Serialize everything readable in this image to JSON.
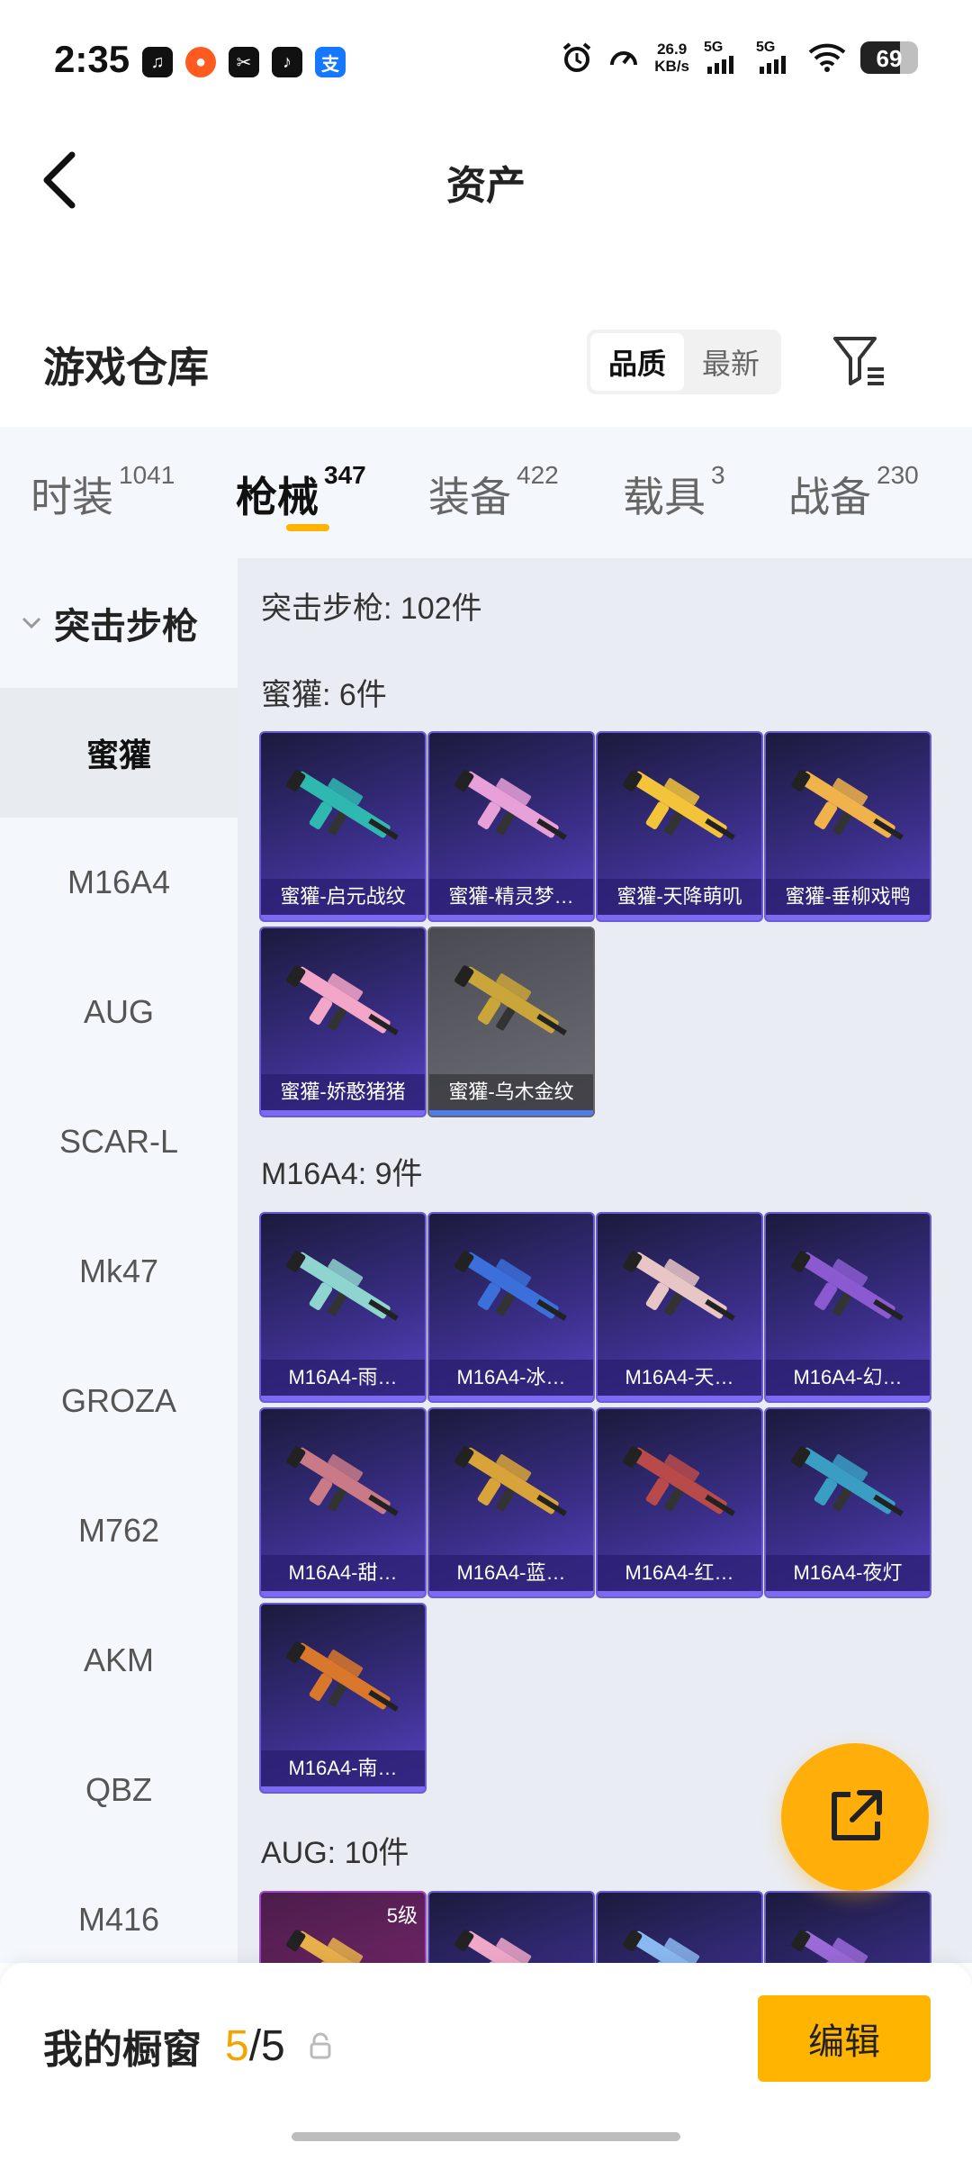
{
  "status_bar": {
    "time": "2:35",
    "net_speed": "26.9",
    "net_unit": "KB/s",
    "sim1": "5G",
    "sim2": "5G",
    "battery": "69",
    "battery_level": 0.69,
    "app_icons": [
      "music-icon",
      "red-app-icon",
      "capcut-icon",
      "tiktok-icon",
      "alipay-icon"
    ]
  },
  "header": {
    "title": "资产"
  },
  "warehouse": {
    "title": "游戏仓库",
    "sort_options": [
      "品质",
      "最新"
    ],
    "sort_selected": "品质"
  },
  "tabs": [
    {
      "label": "时装",
      "count": "1041"
    },
    {
      "label": "枪械",
      "count": "347"
    },
    {
      "label": "装备",
      "count": "422"
    },
    {
      "label": "载具",
      "count": "3"
    },
    {
      "label": "战备",
      "count": "230"
    }
  ],
  "sidebar": {
    "category": "突击步枪",
    "items": [
      "蜜獾",
      "M16A4",
      "AUG",
      "SCAR-L",
      "Mk47",
      "GROZA",
      "M762",
      "AKM",
      "QBZ",
      "M416"
    ],
    "selected": "蜜獾"
  },
  "content": {
    "summary": "突击步枪: 102件",
    "sections": [
      {
        "title": "蜜獾: 6件",
        "items": [
          {
            "name": "蜜獾-启元战纹",
            "color": "#2fb8b0"
          },
          {
            "name": "蜜獾-精灵梦…",
            "color": "#e8a0d8"
          },
          {
            "name": "蜜獾-天降萌叽",
            "color": "#f3c43a"
          },
          {
            "name": "蜜獾-垂柳戏鸭",
            "color": "#f0b24a"
          },
          {
            "name": "蜜獾-娇憨猪猪",
            "color": "#f4a6c8"
          },
          {
            "name": "蜜獾-乌木金纹",
            "color": "#c9a53a"
          }
        ]
      },
      {
        "title": "M16A4: 9件",
        "items": [
          {
            "name": "M16A4-雨…",
            "color": "#8ed4cf"
          },
          {
            "name": "M16A4-冰…",
            "color": "#3b6fd9"
          },
          {
            "name": "M16A4-天…",
            "color": "#e8c6c6"
          },
          {
            "name": "M16A4-幻…",
            "color": "#8b5ad0"
          },
          {
            "name": "M16A4-甜…",
            "color": "#c97a86"
          },
          {
            "name": "M16A4-蓝…",
            "color": "#d8a43a"
          },
          {
            "name": "M16A4-红…",
            "color": "#b84a4a"
          },
          {
            "name": "M16A4-夜灯",
            "color": "#3a9ec4"
          },
          {
            "name": "M16A4-南…",
            "color": "#d9782a"
          }
        ]
      },
      {
        "title": "AUG: 10件",
        "items": [
          {
            "name": "",
            "color": "#e8b04a",
            "level": "5级"
          },
          {
            "name": "",
            "color": "#f0a8c8"
          },
          {
            "name": "",
            "color": "#8ab8f0"
          },
          {
            "name": "",
            "color": "#9a6ad8"
          }
        ]
      }
    ]
  },
  "bottom": {
    "showcase_label": "我的橱窗",
    "current": "5",
    "separator": "/",
    "total": "5",
    "edit_label": "编辑"
  },
  "colors": {
    "accent": "#ffb400",
    "card_border": "#6c5bd6"
  }
}
